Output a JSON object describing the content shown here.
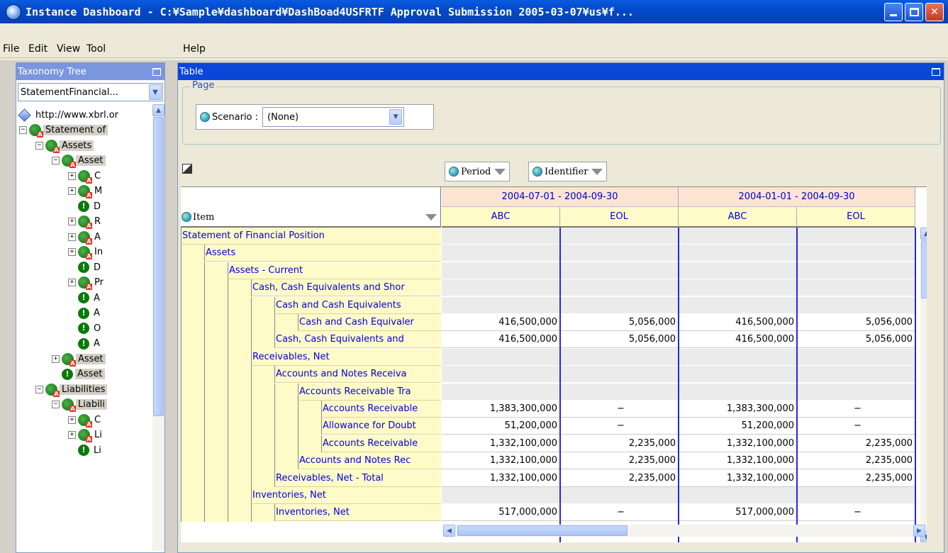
{
  "window": {
    "title": "Instance Dashboard - C:¥Sample¥dashboard¥DashBoad4USFRTF Approval Submission 2005-03-07¥us¥f..."
  },
  "menu": [
    "File",
    "Edit",
    "View",
    "Tool",
    "Help"
  ],
  "left_panel": {
    "title": "Taxonomy Tree",
    "combo_value": "StatementFinancial...",
    "tree": [
      {
        "label": "http://www.xbrl.or",
        "icon": "diamond",
        "level": 0,
        "expander": ""
      },
      {
        "label": "Statement of",
        "icon": "a",
        "level": 1,
        "expander": "−",
        "sel": true
      },
      {
        "label": "Assets",
        "icon": "a",
        "level": 2,
        "expander": "−",
        "sel": true
      },
      {
        "label": "Asset",
        "icon": "a",
        "level": 3,
        "expander": "−",
        "sel": true
      },
      {
        "label": "C",
        "icon": "a",
        "level": 4,
        "expander": "+"
      },
      {
        "label": "M",
        "icon": "a",
        "level": 4,
        "expander": "+"
      },
      {
        "label": "D",
        "icon": "i",
        "level": 4,
        "expander": ""
      },
      {
        "label": "R",
        "icon": "a",
        "level": 4,
        "expander": "+"
      },
      {
        "label": "A",
        "icon": "a",
        "level": 4,
        "expander": "+"
      },
      {
        "label": "In",
        "icon": "a",
        "level": 4,
        "expander": "+"
      },
      {
        "label": "D",
        "icon": "i",
        "level": 4,
        "expander": ""
      },
      {
        "label": "Pr",
        "icon": "a",
        "level": 4,
        "expander": "+"
      },
      {
        "label": "A",
        "icon": "i",
        "level": 4,
        "expander": ""
      },
      {
        "label": "A",
        "icon": "i",
        "level": 4,
        "expander": ""
      },
      {
        "label": "O",
        "icon": "i",
        "level": 4,
        "expander": ""
      },
      {
        "label": "A",
        "icon": "i",
        "level": 4,
        "expander": ""
      },
      {
        "label": "Asset",
        "icon": "a",
        "level": 3,
        "expander": "+",
        "sel": true
      },
      {
        "label": "Asset",
        "icon": "i",
        "level": 3,
        "expander": "",
        "sel": true
      },
      {
        "label": "Liabilities",
        "icon": "a",
        "level": 2,
        "expander": "−",
        "sel": true
      },
      {
        "label": "Liabili",
        "icon": "a",
        "level": 3,
        "expander": "−",
        "sel": true
      },
      {
        "label": "C",
        "icon": "a",
        "level": 4,
        "expander": "+"
      },
      {
        "label": "Li",
        "icon": "a",
        "level": 4,
        "expander": "+"
      },
      {
        "label": "Li",
        "icon": "i",
        "level": 4,
        "expander": ""
      }
    ]
  },
  "right_panel": {
    "title": "Table",
    "page_label": "Page",
    "scenario_label": "Scenario :",
    "scenario_value": "(None)",
    "dim_period": "Period",
    "dim_identifier": "Identifier",
    "item_header": "Item",
    "periods": [
      "2004-07-01 - 2004-09-30",
      "2004-01-01 - 2004-09-30"
    ],
    "identifiers": [
      "ABC",
      "EOL",
      "ABC",
      "EOL"
    ],
    "rows": [
      {
        "label": "Statement of Financial Position",
        "level": 0,
        "values": [
          "",
          "",
          "",
          ""
        ]
      },
      {
        "label": "Assets",
        "level": 1,
        "values": [
          "",
          "",
          "",
          ""
        ]
      },
      {
        "label": "Assets - Current",
        "level": 2,
        "values": [
          "",
          "",
          "",
          ""
        ]
      },
      {
        "label": "Cash, Cash Equivalents and Shor",
        "level": 3,
        "values": [
          "",
          "",
          "",
          ""
        ]
      },
      {
        "label": "Cash and Cash Equivalents",
        "level": 4,
        "values": [
          "",
          "",
          "",
          ""
        ]
      },
      {
        "label": "Cash and Cash Equivaler",
        "level": 5,
        "values": [
          "416,500,000",
          "5,056,000",
          "416,500,000",
          "5,056,000"
        ]
      },
      {
        "label": "Cash, Cash Equivalents and",
        "level": 4,
        "values": [
          "416,500,000",
          "5,056,000",
          "416,500,000",
          "5,056,000"
        ]
      },
      {
        "label": "Receivables, Net",
        "level": 3,
        "values": [
          "",
          "",
          "",
          ""
        ]
      },
      {
        "label": "Accounts and Notes Receiva",
        "level": 4,
        "values": [
          "",
          "",
          "",
          ""
        ]
      },
      {
        "label": "Accounts Receivable Tra",
        "level": 5,
        "values": [
          "",
          "",
          "",
          ""
        ]
      },
      {
        "label": "Accounts Receivable",
        "level": 6,
        "values": [
          "1,383,300,000",
          "−",
          "1,383,300,000",
          "−"
        ]
      },
      {
        "label": "Allowance for Doubt",
        "level": 6,
        "values": [
          "51,200,000",
          "−",
          "51,200,000",
          "−"
        ]
      },
      {
        "label": "Accounts Receivable",
        "level": 6,
        "values": [
          "1,332,100,000",
          "2,235,000",
          "1,332,100,000",
          "2,235,000"
        ]
      },
      {
        "label": "Accounts and Notes Rec",
        "level": 5,
        "values": [
          "1,332,100,000",
          "2,235,000",
          "1,332,100,000",
          "2,235,000"
        ]
      },
      {
        "label": "Receivables, Net - Total",
        "level": 4,
        "values": [
          "1,332,100,000",
          "2,235,000",
          "1,332,100,000",
          "2,235,000"
        ]
      },
      {
        "label": "Inventories, Net",
        "level": 3,
        "values": [
          "",
          "",
          "",
          ""
        ]
      },
      {
        "label": "Inventories, Net",
        "level": 4,
        "values": [
          "517,000,000",
          "−",
          "517,000,000",
          "−"
        ]
      }
    ]
  }
}
